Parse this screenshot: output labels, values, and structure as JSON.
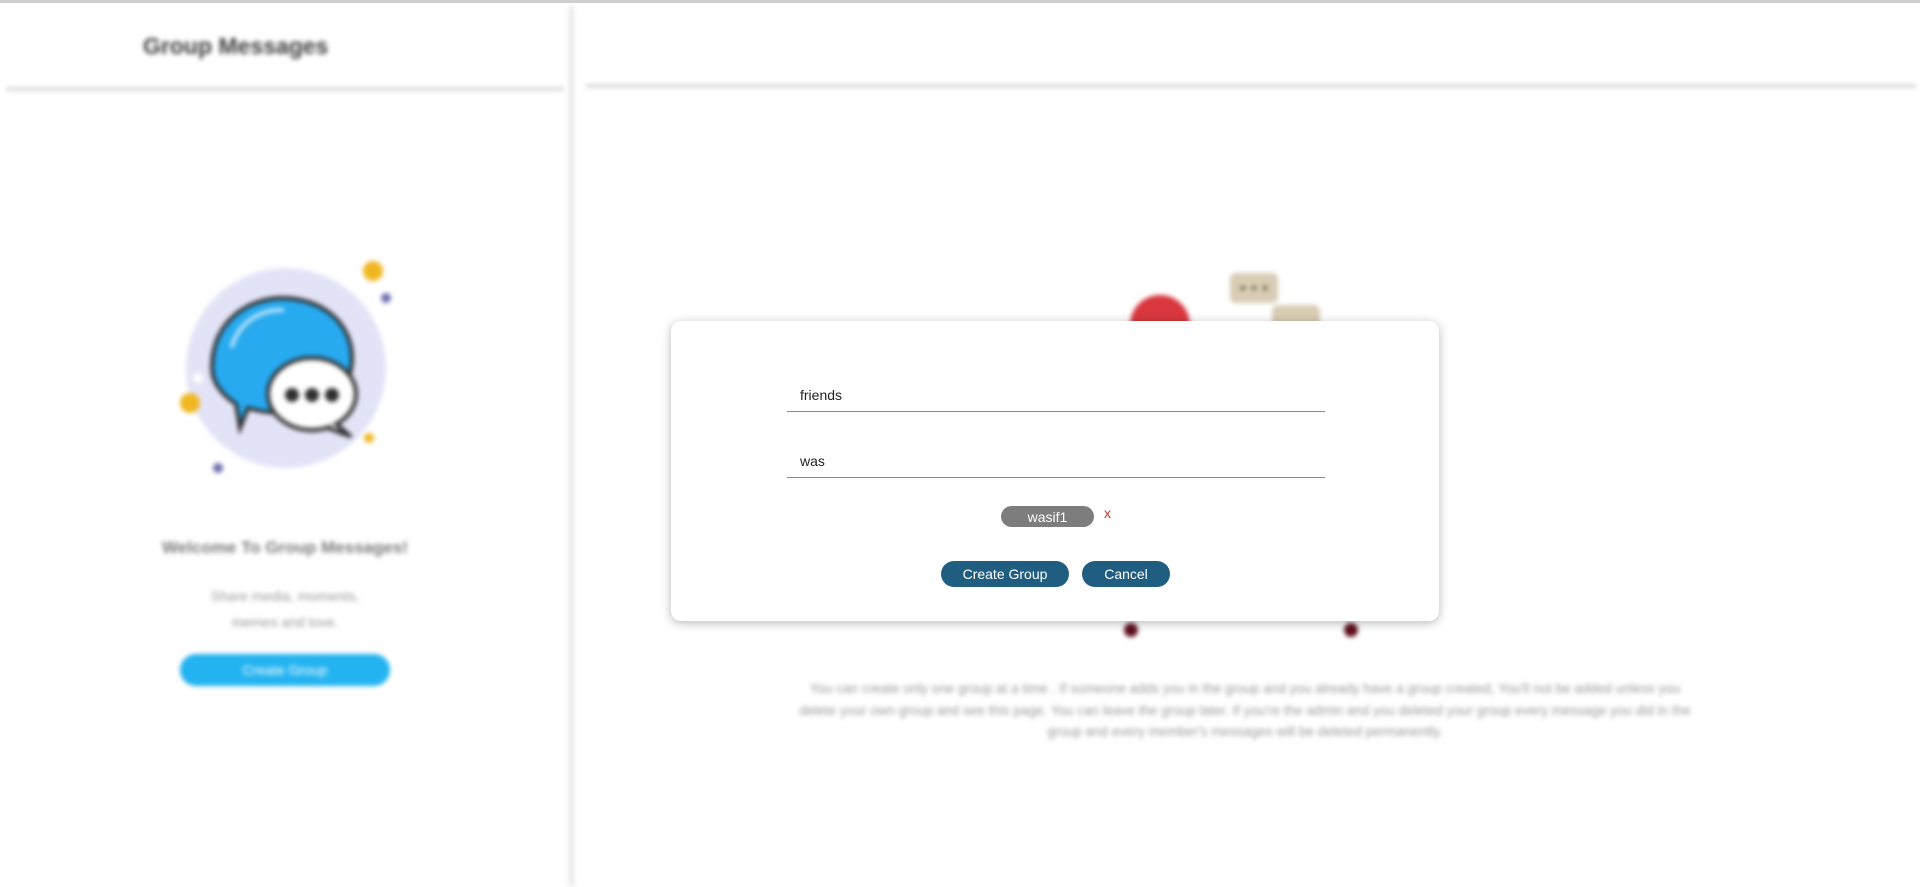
{
  "sidebar": {
    "title": "Group Messages",
    "welcome": "Welcome To Group Messages!",
    "subtitle_line1": "Share media, moments,",
    "subtitle_line2": "memes and love.",
    "create_button": "Create Group"
  },
  "main": {
    "info_line1": "You can create only one group at a time . If someone adds you in the group and you already have a group created, You'll not be added unless you",
    "info_line2": "delete your own group and see this page. You can leave the group later. If you're the admin and you deleted your group every message you did in the",
    "info_line3": "group and every member's messages will be deleted permanently."
  },
  "modal": {
    "group_name_value": "friends",
    "member_search_value": "was",
    "selected_member": "wasif1",
    "remove_member": "x",
    "create_button": "Create Group",
    "cancel_button": "Cancel"
  },
  "colors": {
    "primary_button": "#1f5e80",
    "sidebar_button": "#23b3f0",
    "chip": "#7d7d7d",
    "remove_x": "#c0392b"
  },
  "icons": {
    "hero": "chat-bubbles-icon",
    "illustration": "person-on-sofa-illustration"
  }
}
